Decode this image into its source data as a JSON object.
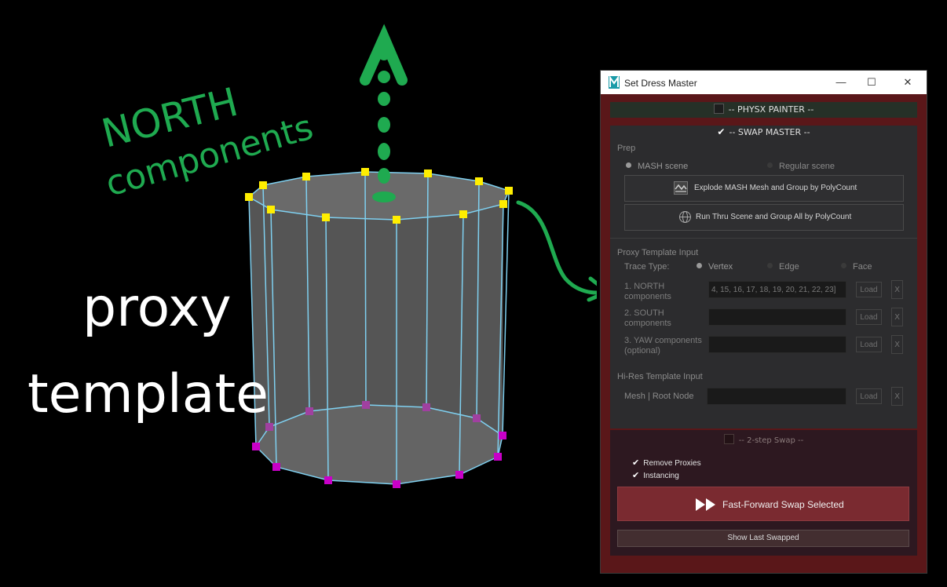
{
  "annotations": {
    "north_line1": "NORTH",
    "north_line2": "components",
    "proxy_line1": "proxy",
    "proxy_line2": "template"
  },
  "window": {
    "title": "Set Dress Master",
    "physx_header": "--  PHYSX PAINTER  --",
    "swap_header": "--  SWAP MASTER  --",
    "prep_label": "Prep",
    "mash_scene": "MASH scene",
    "regular_scene": "Regular scene",
    "explode_btn": "Explode MASH Mesh and Group by PolyCount",
    "run_btn": "Run Thru Scene and Group All by PolyCount",
    "proxy_section": "Proxy Template Input",
    "trace_type": "Trace Type:",
    "trace_vertex": "Vertex",
    "trace_edge": "Edge",
    "trace_face": "Face",
    "north_label1": "1. NORTH",
    "north_label2": "components",
    "north_value": "4, 15, 16, 17, 18, 19, 20, 21, 22, 23]",
    "south_label1": "2. SOUTH",
    "south_label2": "components",
    "yaw_label1": "3. YAW components",
    "yaw_label2": "(optional)",
    "load": "Load",
    "x": "X",
    "hires_section": "Hi-Res Template Input",
    "mesh_root": "Mesh | Root Node",
    "two_step": "--  2-step Swap  --",
    "remove_proxies": "Remove Proxies",
    "instancing": "Instancing",
    "ff_btn": "Fast-Forward Swap Selected",
    "show_last": "Show Last Swapped"
  },
  "colors": {
    "yellow_vertex": "#ffee00",
    "magenta_vertex": "#c800c8",
    "edge": "#7fd0f0",
    "annotation_green": "#1faa50",
    "window_border": "#5a1719"
  }
}
